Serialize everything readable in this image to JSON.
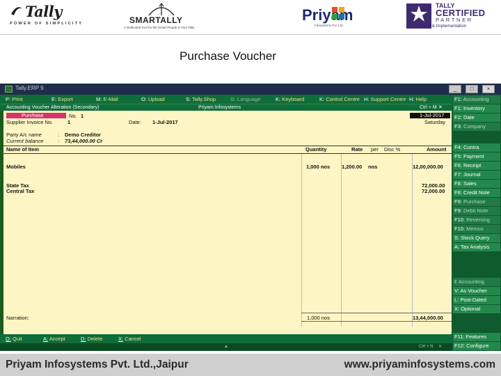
{
  "logos": {
    "tally_word": "Tally",
    "tally_tagline": "POWER OF SIMPLICITY",
    "smarttally_word": "SMARTALLY",
    "smarttally_tagline": "A Dedicated Tool for the Smart People in Your Tally",
    "priyam_word": "Priyam",
    "priyam_tagline": "Infosystems Pvt. Ltd.",
    "cert_line1": "TALLY",
    "cert_line2": "CERTIFIED",
    "cert_line3": "PARTNER",
    "cert_line4": "5 Star Sales & Implementation"
  },
  "slide_title": "Purchase Voucher",
  "window": {
    "title": "Tally.ERP 9",
    "minimize": "_",
    "restore": "□",
    "close": "×"
  },
  "top_menu": [
    {
      "key": "P:",
      "label": "Print"
    },
    {
      "key": "E:",
      "label": "Export"
    },
    {
      "key": "M:",
      "label": "E-Mail"
    },
    {
      "key": "O:",
      "label": "Upload"
    },
    {
      "key": "S:",
      "label": "Tally.Shop"
    },
    {
      "key": "G:",
      "label": "Language"
    },
    {
      "key": "K:",
      "label": "Keyboard"
    },
    {
      "key": "K:",
      "label": "Control Centre"
    },
    {
      "key": "H:",
      "label": "Support Centre"
    },
    {
      "key": "H:",
      "label": "Help"
    }
  ],
  "header": {
    "left": "Accounting Voucher Alteration (Secondary)",
    "center": "Priyam Infosystems",
    "right": "Ctrl + M"
  },
  "voucher": {
    "type": "Purchase",
    "number_label": "No.",
    "number": "1",
    "date": "1-Jul-2017",
    "day": "Saturday",
    "supplier_invoice_label": "Supplier Invoice No.",
    "supplier_invoice_value": "1",
    "date_label": "Date",
    "supplier_date": "1-Jul-2017",
    "party_label": "Party A/c name",
    "party_value": "Demo Creditor",
    "balance_label": "Current balance",
    "balance_value": "73,44,000.00 Cr",
    "col_item": "Name of Item",
    "col_qty": "Quantity",
    "col_rate": "Rate",
    "col_per": "per",
    "col_disc": "Disc %",
    "col_amount": "Amount",
    "items": [
      {
        "name": "Mobiles",
        "qty": "1,000 nos",
        "rate": "1,200.00",
        "per": "nos",
        "amount": "12,00,000.00"
      }
    ],
    "taxes": [
      {
        "name": "State Tax",
        "amount": "72,000.00"
      },
      {
        "name": "Central Tax",
        "amount": "72,000.00"
      }
    ],
    "narration_label": "Narration:",
    "total_qty": "1,000 nos",
    "total_amount": "13,44,000.00"
  },
  "right_buttons": [
    {
      "key": "F1:",
      "label": "Accounting"
    },
    {
      "key": "F1:",
      "label": "Inventory"
    },
    {
      "key": "F2:",
      "label": "Date"
    },
    {
      "key": "F3:",
      "label": "Company"
    },
    {
      "key": "F4:",
      "label": "Contra"
    },
    {
      "key": "F5:",
      "label": "Payment"
    },
    {
      "key": "F6:",
      "label": "Receipt"
    },
    {
      "key": "F7:",
      "label": "Journal"
    },
    {
      "key": "F8:",
      "label": "Sales"
    },
    {
      "key": "F8:",
      "label": "Credit Note"
    },
    {
      "key": "F9:",
      "label": "Purchase"
    },
    {
      "key": "F9:",
      "label": "Debit Note"
    },
    {
      "key": "F10:",
      "label": "Reversing"
    },
    {
      "key": "F10:",
      "label": "Memos"
    },
    {
      "key": "S:",
      "label": "Stock Query"
    },
    {
      "key": "A:",
      "label": "Tax Analysis"
    },
    {
      "key": "I:",
      "label": "Accounting"
    },
    {
      "key": "V:",
      "label": "As Voucher"
    },
    {
      "key": "L:",
      "label": "Post-Dated"
    },
    {
      "key": "X:",
      "label": "Optional"
    },
    {
      "key": "F11:",
      "label": "Features"
    },
    {
      "key": "F12:",
      "label": "Configure"
    }
  ],
  "bottom_menu": [
    {
      "key": "Q:",
      "label": "Quit"
    },
    {
      "key": "A:",
      "label": "Accept"
    },
    {
      "key": "D:",
      "label": "Delete"
    },
    {
      "key": "X:",
      "label": "Cancel"
    }
  ],
  "status": {
    "right": "Ctrl + N"
  },
  "footer": {
    "left": "Priyam Infosystems Pvt. Ltd.,Jaipur",
    "right": "www.priyaminfosystems.com"
  },
  "colors": {
    "voucher_bg": "#fdf6c4",
    "button_bar": "#0f6d3a",
    "voucher_type_badge": "#d8336a",
    "window_title": "#1f2d4a"
  }
}
